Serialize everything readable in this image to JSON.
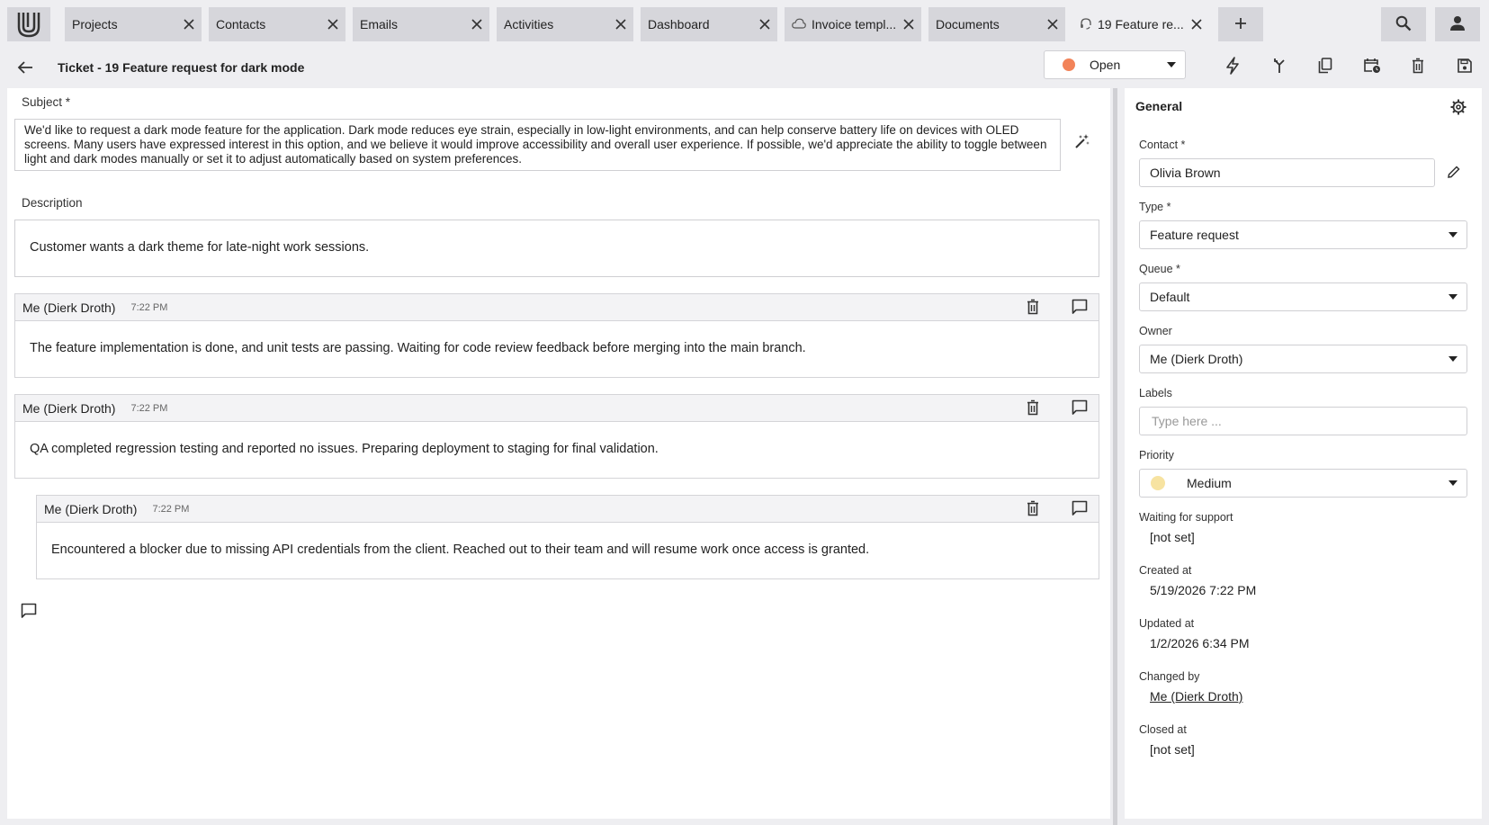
{
  "tabs": [
    {
      "label": "Projects",
      "icon": "",
      "active": false
    },
    {
      "label": "Contacts",
      "icon": "",
      "active": false
    },
    {
      "label": "Emails",
      "icon": "",
      "active": false
    },
    {
      "label": "Activities",
      "icon": "",
      "active": false
    },
    {
      "label": "Dashboard",
      "icon": "",
      "active": false
    },
    {
      "label": "Invoice templ...",
      "icon": "cloud-icon",
      "active": false
    },
    {
      "label": "Documents",
      "icon": "",
      "active": false
    },
    {
      "label": "19 Feature re...",
      "icon": "headset-icon",
      "active": true
    }
  ],
  "header": {
    "title": "Ticket - 19 Feature request for dark mode",
    "status": {
      "label": "Open",
      "color": "#f28359"
    }
  },
  "subject": {
    "label": "Subject *",
    "text": "We'd like to request a dark mode feature for the application. Dark mode reduces eye strain, especially in low-light environments, and can help conserve battery life on devices with OLED screens. Many users have expressed interest in this option, and we believe it would improve accessibility and overall user experience. If possible, we'd appreciate the ability to toggle between light and dark modes manually or set it to adjust automatically based on system preferences."
  },
  "description": {
    "label": "Description",
    "text": "Customer wants a dark theme for late-night work sessions."
  },
  "comments": [
    {
      "author": "Me (Dierk Droth)",
      "time": "7:22 PM",
      "text": "The feature implementation is done, and unit tests are passing. Waiting for code review feedback before merging into the main branch."
    },
    {
      "author": "Me (Dierk Droth)",
      "time": "7:22 PM",
      "text": "QA completed regression testing and reported no issues. Preparing deployment to staging for final validation."
    },
    {
      "author": "Me (Dierk Droth)",
      "time": "7:22 PM",
      "text": "Encountered a blocker due to missing API credentials from the client. Reached out to their team and will resume work once access is granted."
    }
  ],
  "general": {
    "title": "General",
    "contact": {
      "label": "Contact *",
      "value": "Olivia Brown"
    },
    "type": {
      "label": "Type *",
      "value": "Feature request"
    },
    "queue": {
      "label": "Queue *",
      "value": "Default"
    },
    "owner": {
      "label": "Owner",
      "value": "Me (Dierk Droth)"
    },
    "labels": {
      "label": "Labels",
      "placeholder": "Type here ..."
    },
    "priority": {
      "label": "Priority",
      "value": "Medium",
      "color": "#f7e3a1"
    },
    "waiting": {
      "label": "Waiting for support",
      "value": "[not set]"
    },
    "created": {
      "label": "Created at",
      "value": "5/19/2026 7:22 PM"
    },
    "updated": {
      "label": "Updated at",
      "value": "1/2/2026 6:34 PM"
    },
    "changed": {
      "label": "Changed by",
      "value": "Me (Dierk Droth)"
    },
    "closed": {
      "label": "Closed at",
      "value": "[not set]"
    }
  }
}
